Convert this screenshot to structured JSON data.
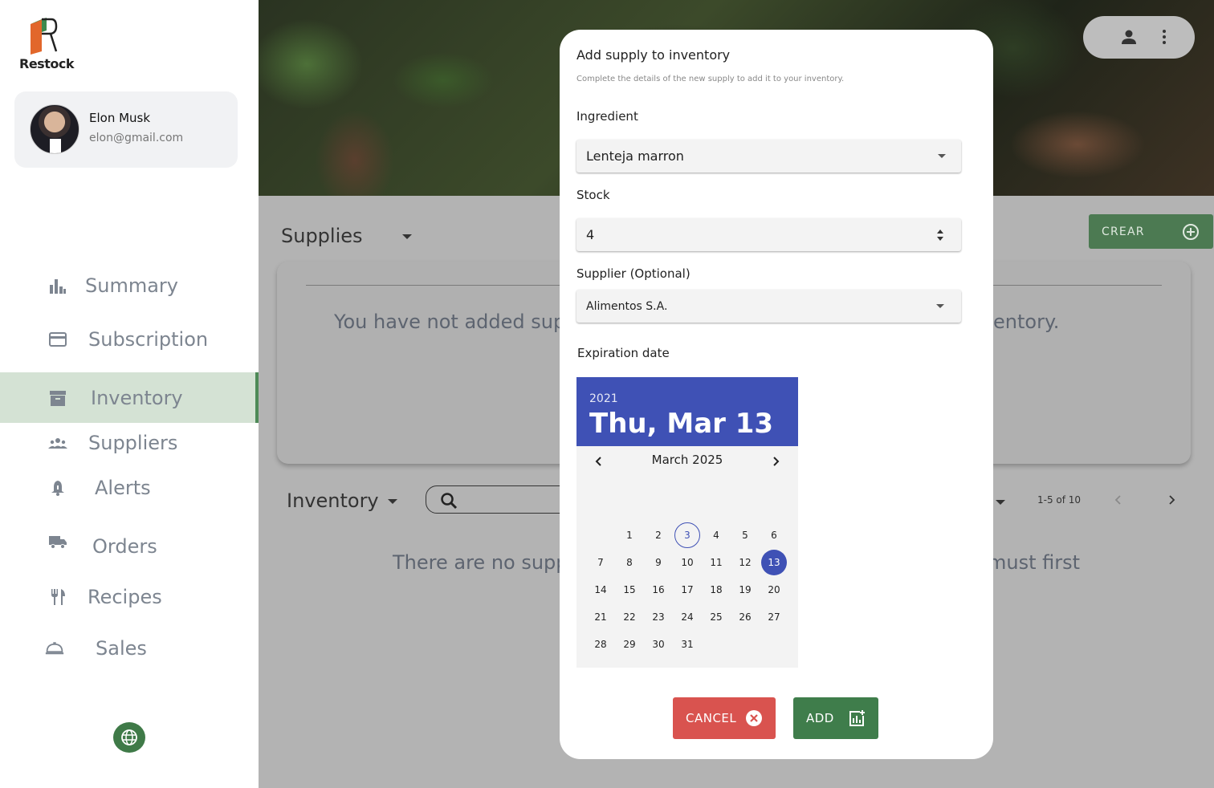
{
  "app": {
    "name": "Restock"
  },
  "profile": {
    "name": "Elon Musk",
    "email": "elon@gmail.com"
  },
  "sidebar": {
    "items": [
      {
        "label": "Summary",
        "icon": "bar-chart-icon"
      },
      {
        "label": "Subscription",
        "icon": "credit-card-icon"
      },
      {
        "label": "Inventory",
        "icon": "archive-icon",
        "active": true
      },
      {
        "label": "Suppliers",
        "icon": "groups-icon"
      },
      {
        "label": "Alerts",
        "icon": "bell-icon"
      },
      {
        "label": "Orders",
        "icon": "truck-icon"
      },
      {
        "label": "Recipes",
        "icon": "restaurant-icon"
      },
      {
        "label": "Sales",
        "icon": "room-service-icon"
      }
    ],
    "language_icon": "globe-icon"
  },
  "main": {
    "supplies_title": "Supplies",
    "crear_label": "CREAR",
    "supplies_empty_left": "You have not added sup",
    "supplies_empty_right": "entory.",
    "inventory_title": "Inventory",
    "inventory_empty_left": "There are no supp",
    "inventory_empty_right": "must first",
    "pager": "1-5 of 10"
  },
  "modal": {
    "title": "Add supply to inventory",
    "subtitle": "Complete the details of the new supply to add it to your inventory.",
    "ingredient_label": "Ingredient",
    "ingredient_value": "Lenteja marron",
    "stock_label": "Stock",
    "stock_value": "4",
    "supplier_label": "Supplier (Optional)",
    "supplier_value": "Alimentos S.A.",
    "expiration_label": "Expiration date",
    "calendar": {
      "year": "2021",
      "selected_label": "Thu, Mar 13",
      "month_label": "March 2025",
      "first_weekday": 1,
      "days_in_month": 31,
      "today": 3,
      "selected": 13
    },
    "cancel_label": "CANCEL",
    "add_label": "ADD"
  },
  "colors": {
    "brand_green": "#4c7a52",
    "calendar_blue": "#3f51b5",
    "cancel_red": "#d9534f",
    "active_nav_bg": "#d4e2d4"
  }
}
